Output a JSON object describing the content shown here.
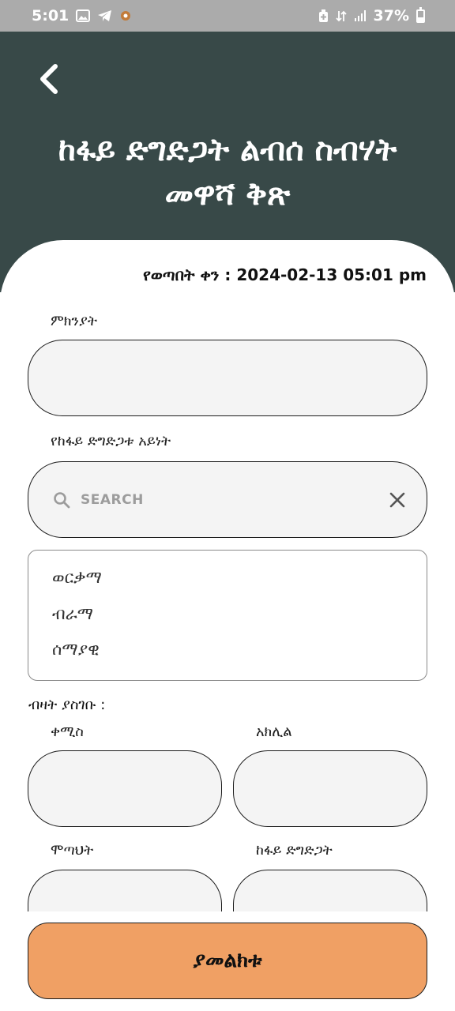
{
  "status_bar": {
    "time": "5:01",
    "battery_percent": "37%",
    "battery_level": 0.37
  },
  "header": {
    "title_line1": "ከፋይ ድግድጋት ልብሰ ስብሃት",
    "title_line2": "መዋሻ ቅጽ"
  },
  "form": {
    "date_label": "የወጣበት ቀን : 2024-02-13 05:01 pm",
    "reason_label": "ምክንያት",
    "reason_value": "",
    "type_label": "የከፋይ ድግድጋቱ አይነት",
    "search_placeholder": "SEARCH",
    "options": [
      "ወርቃማ",
      "ብራማ",
      "ሰማያዊ"
    ],
    "quantity_label": "ብዛት ያስገቡ :",
    "qty_fields": [
      {
        "label": "ቀሚስ",
        "value": ""
      },
      {
        "label": "አክሊል",
        "value": ""
      },
      {
        "label": "ሞጣህት",
        "value": ""
      },
      {
        "label": "ከፋይ ድግድጋት",
        "value": ""
      }
    ]
  },
  "submit_label": "ያመልክቱ",
  "colors": {
    "header_bg": "#384948",
    "submit_bg": "#f0a064",
    "status_bg": "#ababab"
  }
}
